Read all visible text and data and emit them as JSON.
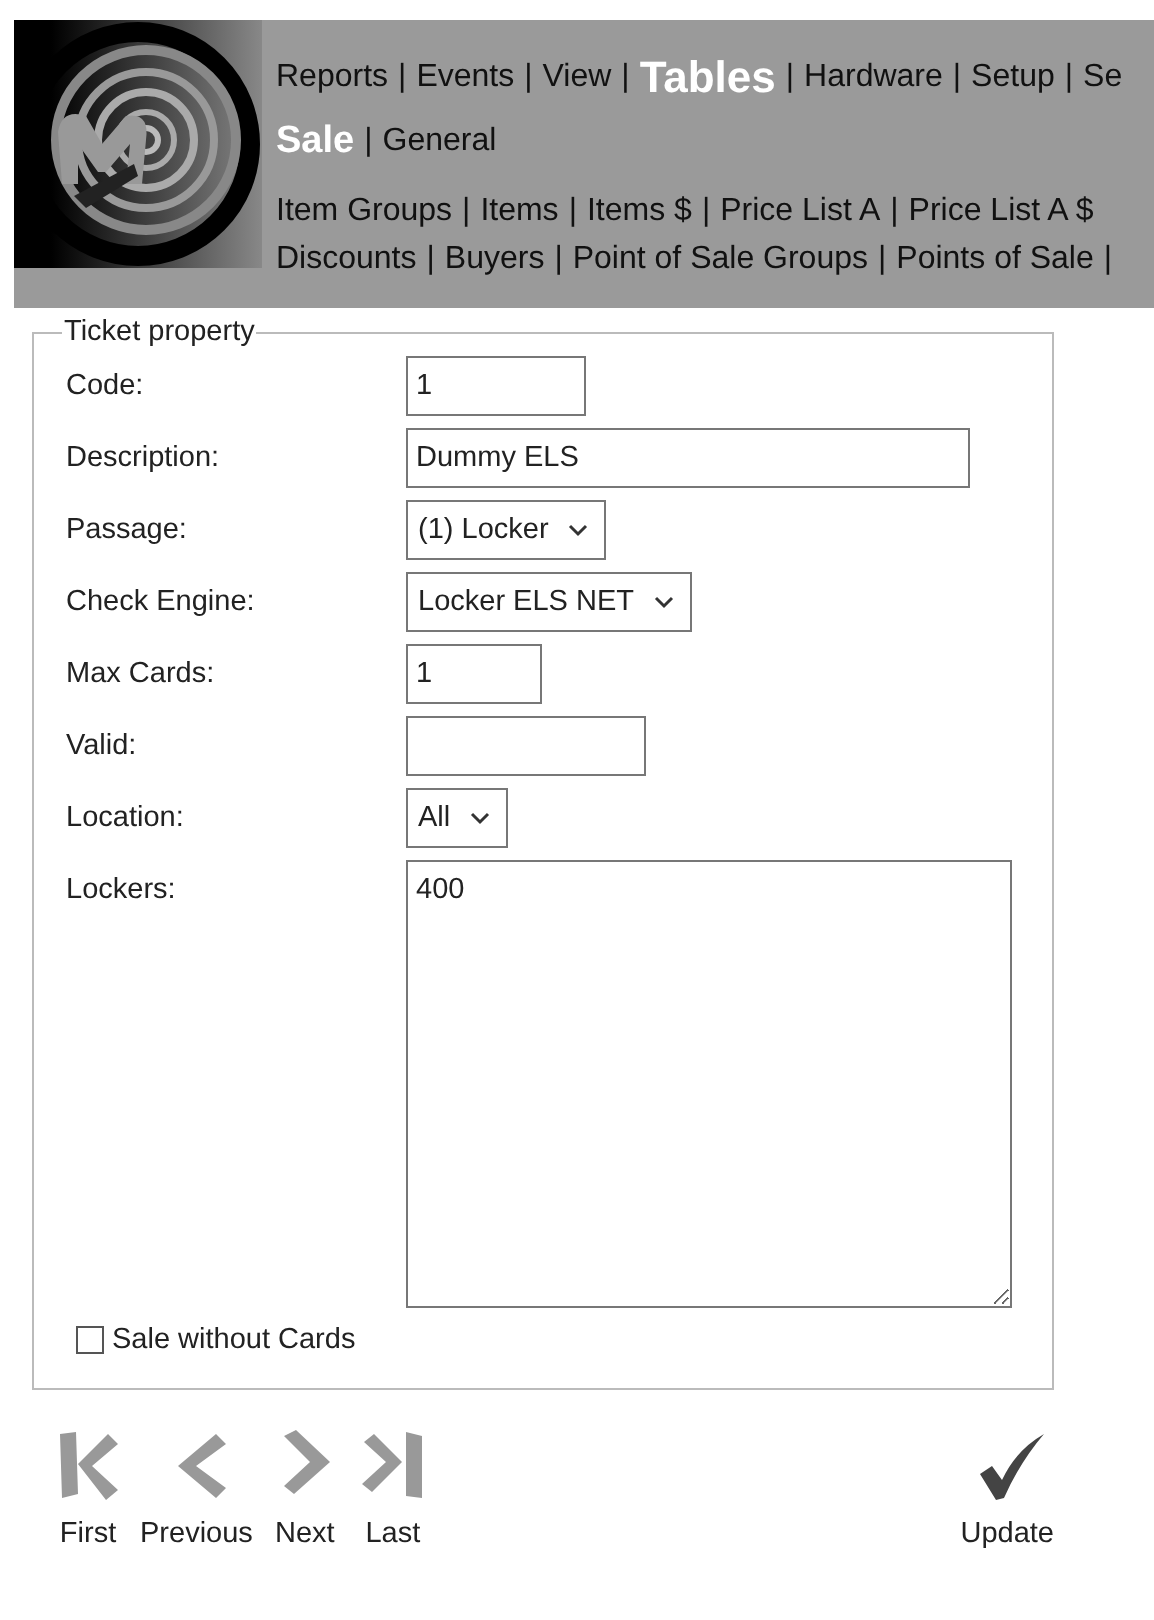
{
  "header": {
    "menu_rows": [
      {
        "kind": "main",
        "separator": "|",
        "ends_with_separator": false,
        "items": [
          {
            "label": "Reports",
            "selected": false
          },
          {
            "label": "Events",
            "selected": false
          },
          {
            "label": "View",
            "selected": false
          },
          {
            "label": "Tables",
            "selected": true
          },
          {
            "label": "Hardware",
            "selected": false
          },
          {
            "label": "Setup",
            "selected": false
          },
          {
            "label": "Se",
            "selected": false
          }
        ]
      },
      {
        "kind": "section",
        "separator": "|",
        "ends_with_separator": false,
        "items": [
          {
            "label": "Sale",
            "selected": true
          },
          {
            "label": "General",
            "selected": false
          }
        ]
      },
      {
        "kind": "sub",
        "separator": "|",
        "ends_with_separator": false,
        "items": [
          {
            "label": "Item Groups",
            "selected": false
          },
          {
            "label": "Items",
            "selected": false
          },
          {
            "label": "Items $",
            "selected": false
          },
          {
            "label": "Price List A",
            "selected": false
          },
          {
            "label": "Price List A $",
            "selected": false
          }
        ]
      },
      {
        "kind": "sub",
        "separator": "|",
        "ends_with_separator": true,
        "items": [
          {
            "label": "Discounts",
            "selected": false
          },
          {
            "label": "Buyers",
            "selected": false
          },
          {
            "label": "Point of Sale Groups",
            "selected": false
          },
          {
            "label": "Points of Sale",
            "selected": false
          }
        ]
      }
    ]
  },
  "form": {
    "legend": "Ticket property",
    "fields": [
      {
        "kind": "text",
        "label": "Code:",
        "value": "1"
      },
      {
        "kind": "text",
        "label": "Description:",
        "value": "Dummy ELS"
      },
      {
        "kind": "select",
        "label": "Passage:",
        "value": "(1) Locker"
      },
      {
        "kind": "select",
        "label": "Check Engine:",
        "value": "Locker ELS NET"
      },
      {
        "kind": "text",
        "label": "Max Cards:",
        "value": "1"
      },
      {
        "kind": "text",
        "label": "Valid:"
      },
      {
        "kind": "select",
        "label": "Location:",
        "value": "All"
      },
      {
        "kind": "textarea",
        "label": "Lockers:",
        "value": "400"
      }
    ],
    "checkbox": {
      "label": "Sale without Cards",
      "checked": false
    }
  },
  "navigation": [
    {
      "kind": "first",
      "label": "First"
    },
    {
      "kind": "previous",
      "label": "Previous"
    },
    {
      "kind": "next",
      "label": "Next"
    },
    {
      "kind": "last",
      "label": "Last"
    }
  ],
  "update": {
    "label": "Update"
  }
}
